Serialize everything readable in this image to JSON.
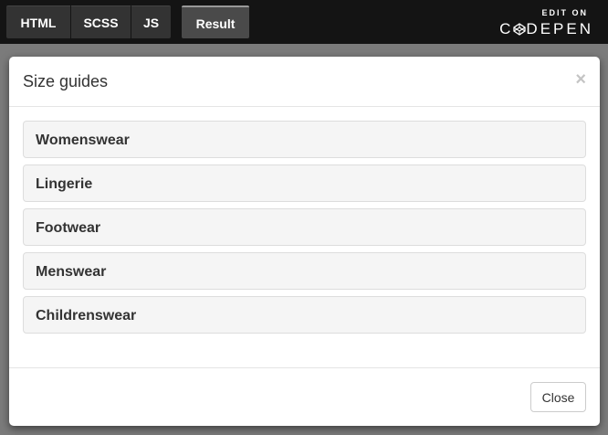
{
  "editor_tabs": {
    "html": "HTML",
    "scss": "SCSS",
    "js": "JS",
    "result": "Result"
  },
  "codepen": {
    "edit_on": "EDIT ON",
    "brand_prefix": "C",
    "brand_suffix": "DEPEN"
  },
  "modal": {
    "title": "Size guides",
    "close_glyph": "×",
    "panels": [
      {
        "label": "Womenswear"
      },
      {
        "label": "Lingerie"
      },
      {
        "label": "Footwear"
      },
      {
        "label": "Menswear"
      },
      {
        "label": "Childrenswear"
      }
    ],
    "footer_button": "Close"
  },
  "colors": {
    "topbar": "#141414",
    "backdrop": "#7b7b7b",
    "panel_bg": "#f5f5f5"
  }
}
